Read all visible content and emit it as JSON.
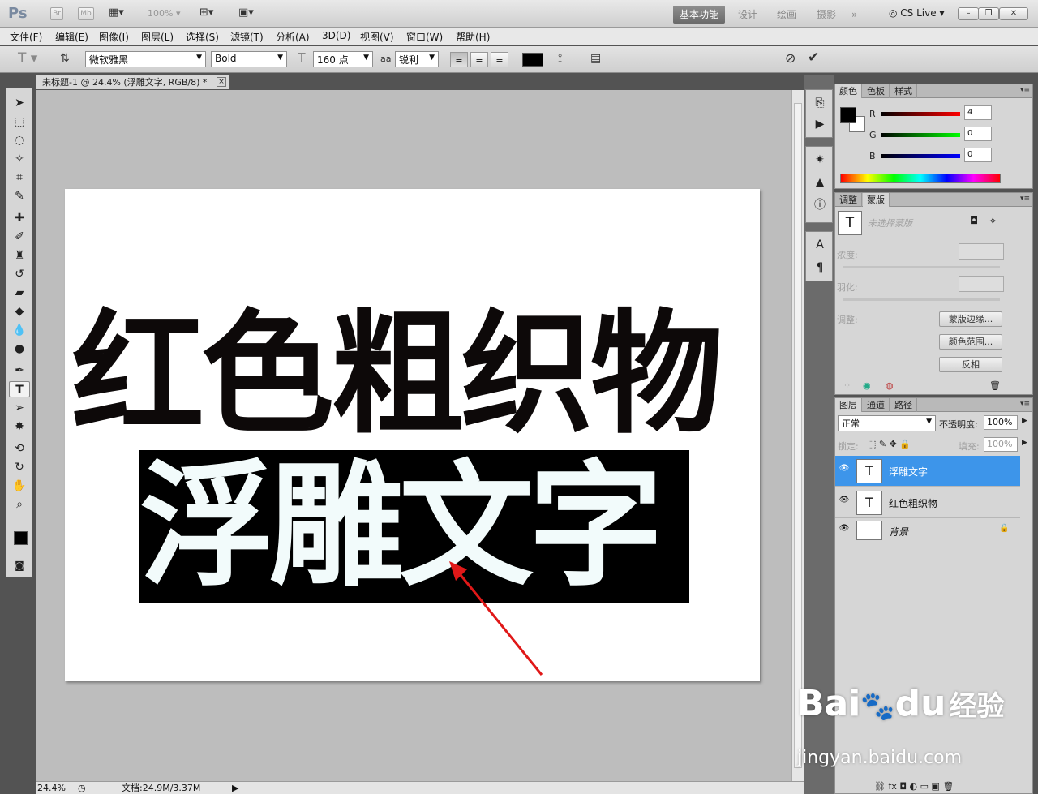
{
  "app": {
    "logo": "Ps",
    "bridge_label": "Br",
    "minibridge_label": "Mb",
    "zoom_level": "100%",
    "workspaces": [
      "基本功能",
      "设计",
      "绘画",
      "摄影"
    ],
    "cs_live": "CS Live",
    "more": "»"
  },
  "menu": [
    "文件(F)",
    "编辑(E)",
    "图像(I)",
    "图层(L)",
    "选择(S)",
    "滤镜(T)",
    "分析(A)",
    "3D(D)",
    "视图(V)",
    "窗口(W)",
    "帮助(H)"
  ],
  "options": {
    "font_family": "微软雅黑",
    "font_style": "Bold",
    "font_size": "160 点",
    "antialias_icon": "aa",
    "antialias": "锐利",
    "text_color": "#000000"
  },
  "document": {
    "tab_title": "未标题-1 @ 24.4% (浮雕文字, RGB/8) *",
    "close": "×",
    "line1": "红色粗织物",
    "line2": "浮雕文字"
  },
  "status": {
    "zoom": "24.4%",
    "doc_info": "文档:24.9M/3.37M"
  },
  "color_panel": {
    "tabs": [
      "颜色",
      "色板",
      "样式"
    ],
    "channels": [
      {
        "label": "R",
        "value": "4"
      },
      {
        "label": "G",
        "value": "0"
      },
      {
        "label": "B",
        "value": "0"
      }
    ],
    "foreground": "#040000",
    "background": "#ffffff"
  },
  "masks_panel": {
    "tabs": [
      "调整",
      "蒙版"
    ],
    "no_mask": "未选择蒙版",
    "density": "浓度:",
    "feather": "羽化:",
    "refine": "调整:",
    "mask_edge": "蒙版边缘...",
    "color_range": "颜色范围...",
    "invert": "反相"
  },
  "layers_panel": {
    "tabs": [
      "图层",
      "通道",
      "路径"
    ],
    "blend_mode": "正常",
    "opacity_label": "不透明度:",
    "opacity": "100%",
    "lock_label": "锁定:",
    "fill_label": "填充:",
    "fill": "100%",
    "layers": [
      {
        "name": "浮雕文字",
        "type": "T",
        "active": true
      },
      {
        "name": "红色粗织物",
        "type": "T",
        "active": false
      },
      {
        "name": "背景",
        "type": "",
        "active": false
      }
    ]
  },
  "watermark": {
    "brand": "Bai",
    "brand2": "du",
    "cn": "经验",
    "url": "jingyan.baidu.com"
  }
}
